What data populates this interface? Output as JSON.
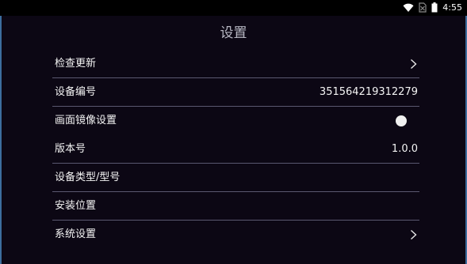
{
  "status_bar": {
    "time": "4:55",
    "icons": [
      "wifi-icon",
      "no-sim-icon",
      "battery-icon"
    ]
  },
  "page": {
    "title": "设置"
  },
  "settings": {
    "items": [
      {
        "label": "检查更新",
        "value": "",
        "control": "chevron"
      },
      {
        "label": "设备编号",
        "value": "351564219312279",
        "control": "value"
      },
      {
        "label": "画面镜像设置",
        "value": "",
        "control": "toggle",
        "toggle_on": false
      },
      {
        "label": "版本号",
        "value": "1.0.0",
        "control": "value"
      },
      {
        "label": "设备类型/型号",
        "value": "",
        "control": "none"
      },
      {
        "label": "安装位置",
        "value": "",
        "control": "none"
      },
      {
        "label": "系统设置",
        "value": "",
        "control": "chevron"
      }
    ]
  },
  "colors": {
    "background": "#0c0714",
    "status_bar": "#000000",
    "divider": "#5a5870",
    "title": "#b8b8c4",
    "text": "#f4f4f4",
    "edge_accent": "#3c6e9e"
  }
}
